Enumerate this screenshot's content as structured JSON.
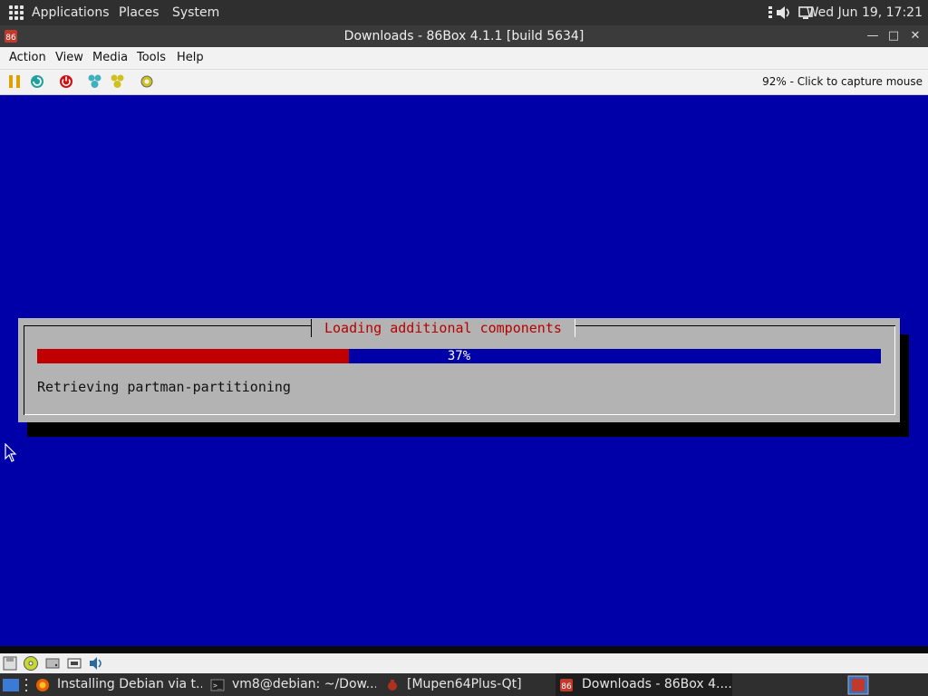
{
  "top_panel": {
    "menus": [
      "Applications",
      "Places",
      "System"
    ],
    "clock": "Wed Jun 19, 17:21",
    "tray_icons": [
      "network-icon",
      "volume-icon",
      "display-icon"
    ]
  },
  "window": {
    "title": "Downloads - 86Box 4.1.1 [build 5634]",
    "buttons": [
      "minimize",
      "maximize",
      "close"
    ]
  },
  "menubar": {
    "items": [
      "Action",
      "View",
      "Media",
      "Tools",
      "Help"
    ],
    "underline_first": [
      "A",
      "V",
      "M",
      "T",
      "H"
    ]
  },
  "toolbar": {
    "buttons": [
      "pause-icon",
      "reset-icon",
      "power-icon",
      "ctrl-alt-del-icon",
      "ctrl-alt-esc-icon",
      "settings-icon"
    ],
    "status": "92% - Click to capture mouse"
  },
  "installer": {
    "dialog_title": "Loading additional components",
    "progress_fraction": 0.37,
    "progress_label": "37%",
    "message": "Retrieving partman-partitioning"
  },
  "statusbar_icons": [
    "floppy-icon",
    "cdrom-icon",
    "hdd-icon",
    "network-card-icon",
    "sound-icon"
  ],
  "taskbar": {
    "items": [
      {
        "label": "Installing Debian via t...",
        "icon": "firefox-icon",
        "active": false
      },
      {
        "label": "vm8@debian: ~/Dow...",
        "icon": "terminal-icon",
        "active": false
      },
      {
        "label": "[Mupen64Plus-Qt]",
        "icon": "mupen-icon",
        "active": false
      },
      {
        "label": "Downloads - 86Box 4....",
        "icon": "86box-icon",
        "active": true
      }
    ]
  },
  "colors": {
    "screen_bg": "#0000a8",
    "dialog_bg": "#b3b3b3",
    "progress_fill": "#c00000",
    "dialog_title": "#b80000"
  }
}
